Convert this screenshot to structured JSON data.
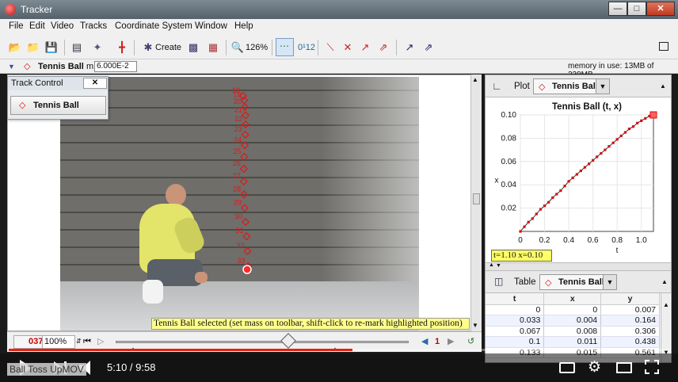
{
  "window": {
    "title": "Tracker",
    "minimize_label": "—",
    "maximize_label": "□",
    "close_label": "✕"
  },
  "menu": [
    "File",
    "Edit",
    "Video",
    "Tracks",
    "Coordinate System",
    "Window",
    "Help"
  ],
  "toolbar": {
    "create_label": "Create",
    "zoom_label": "126%",
    "num_label": "0¹12"
  },
  "trackbar": {
    "track_name": "Tennis Ball",
    "mass_label": "m",
    "mass_value": "6.000E-2",
    "memory_text": "memory in use: 13MB of 239MB"
  },
  "track_control": {
    "title": "Track Control",
    "close_label": "✕",
    "track_button": "Tennis Ball"
  },
  "video": {
    "marker_labels": [
      "18",
      "19",
      "20",
      "21",
      "22",
      "23",
      "24",
      "25",
      "26",
      "27",
      "28",
      "29",
      "30",
      "31",
      "32",
      "33"
    ],
    "status_message": "Tennis Ball selected (set mass on toolbar, shift-click to re-mark highlighted position)"
  },
  "player": {
    "frame_number": "037",
    "zoom": "100%",
    "step_size": "1",
    "slider_position": 0.59
  },
  "plot": {
    "panel_label": "Plot",
    "track_label": "Tennis Ball",
    "readout": "t=1.10  x=0.10"
  },
  "chart_data": {
    "type": "scatter",
    "title": "Tennis Ball (t, x)",
    "xlabel": "t",
    "ylabel": "x",
    "xlim": [
      0,
      1.1
    ],
    "ylim": [
      0,
      0.1
    ],
    "xticks": [
      "0",
      "0.2",
      "0.4",
      "0.6",
      "0.8",
      "1.0"
    ],
    "yticks": [
      "0.02",
      "0.04",
      "0.06",
      "0.08",
      "0.10"
    ],
    "grid": true,
    "series": [
      {
        "x": [
          0,
          0.033,
          0.067,
          0.1,
          0.133,
          0.167,
          0.2,
          0.233,
          0.267,
          0.3,
          0.333,
          0.367,
          0.4,
          0.433,
          0.467,
          0.5,
          0.533,
          0.567,
          0.6,
          0.633,
          0.667,
          0.7,
          0.733,
          0.767,
          0.8,
          0.833,
          0.867,
          0.9,
          0.933,
          0.967,
          1.0,
          1.033,
          1.067,
          1.1
        ],
        "y": [
          0,
          0.004,
          0.008,
          0.011,
          0.015,
          0.019,
          0.022,
          0.025,
          0.029,
          0.032,
          0.035,
          0.039,
          0.043,
          0.046,
          0.049,
          0.052,
          0.055,
          0.058,
          0.061,
          0.064,
          0.067,
          0.07,
          0.073,
          0.076,
          0.079,
          0.082,
          0.085,
          0.088,
          0.09,
          0.093,
          0.095,
          0.097,
          0.099,
          0.1
        ]
      }
    ],
    "colors": {
      "marker": "#d01010",
      "highlight": "#ff6060"
    }
  },
  "table": {
    "panel_label": "Table",
    "track_label": "Tennis Ball",
    "columns": [
      "t",
      "x",
      "y"
    ],
    "rows": [
      [
        "0",
        "0",
        "0.007"
      ],
      [
        "0.033",
        "0.004",
        "0.164"
      ],
      [
        "0.067",
        "0.008",
        "0.306"
      ],
      [
        "0.1",
        "0.011",
        "0.438"
      ],
      [
        "0.133",
        "0.015",
        "0.561"
      ]
    ]
  },
  "youtube": {
    "time": "5:10 / 9:58",
    "progress": 0.52,
    "background_title": "Ball Toss UpMOV"
  }
}
